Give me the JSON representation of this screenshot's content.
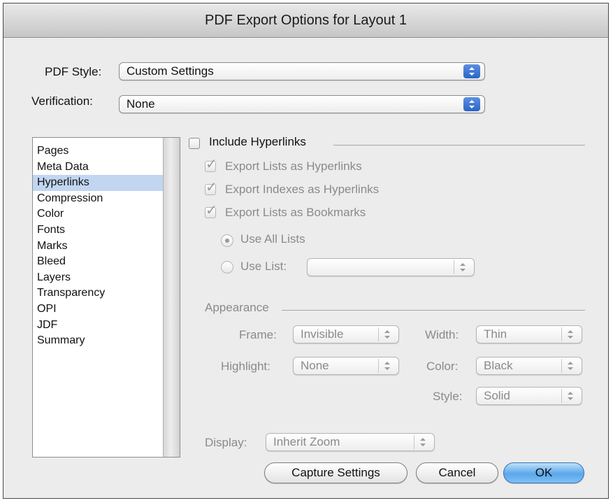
{
  "window": {
    "title": "PDF Export Options for Layout 1"
  },
  "pdf_style": {
    "label": "PDF Style:",
    "value": "Custom Settings"
  },
  "verification": {
    "label": "Verification:",
    "value": "None"
  },
  "categories": {
    "items": [
      "Pages",
      "Meta Data",
      "Hyperlinks",
      "Compression",
      "Color",
      "Fonts",
      "Marks",
      "Bleed",
      "Layers",
      "Transparency",
      "OPI",
      "JDF",
      "Summary"
    ],
    "selected": "Hyperlinks"
  },
  "hyperlinks": {
    "include_label": "Include Hyperlinks",
    "include_checked": false,
    "export_lists_label": "Export Lists as Hyperlinks",
    "export_lists_checked": true,
    "export_indexes_label": "Export Indexes as Hyperlinks",
    "export_indexes_checked": true,
    "export_bookmarks_label": "Export Lists as Bookmarks",
    "export_bookmarks_checked": true,
    "use_all_lists_label": "Use All Lists",
    "use_all_lists_selected": true,
    "use_list_label": "Use List:",
    "use_list_value": ""
  },
  "appearance": {
    "heading": "Appearance",
    "frame_label": "Frame:",
    "frame_value": "Invisible",
    "highlight_label": "Highlight:",
    "highlight_value": "None",
    "width_label": "Width:",
    "width_value": "Thin",
    "color_label": "Color:",
    "color_value": "Black",
    "style_label": "Style:",
    "style_value": "Solid"
  },
  "display": {
    "label": "Display:",
    "value": "Inherit Zoom"
  },
  "buttons": {
    "capture": "Capture Settings",
    "cancel": "Cancel",
    "ok": "OK"
  },
  "colors": {
    "accent": "#2a64c8",
    "selection": "#c2d6f2",
    "ok_button": "#5aa7ea"
  }
}
